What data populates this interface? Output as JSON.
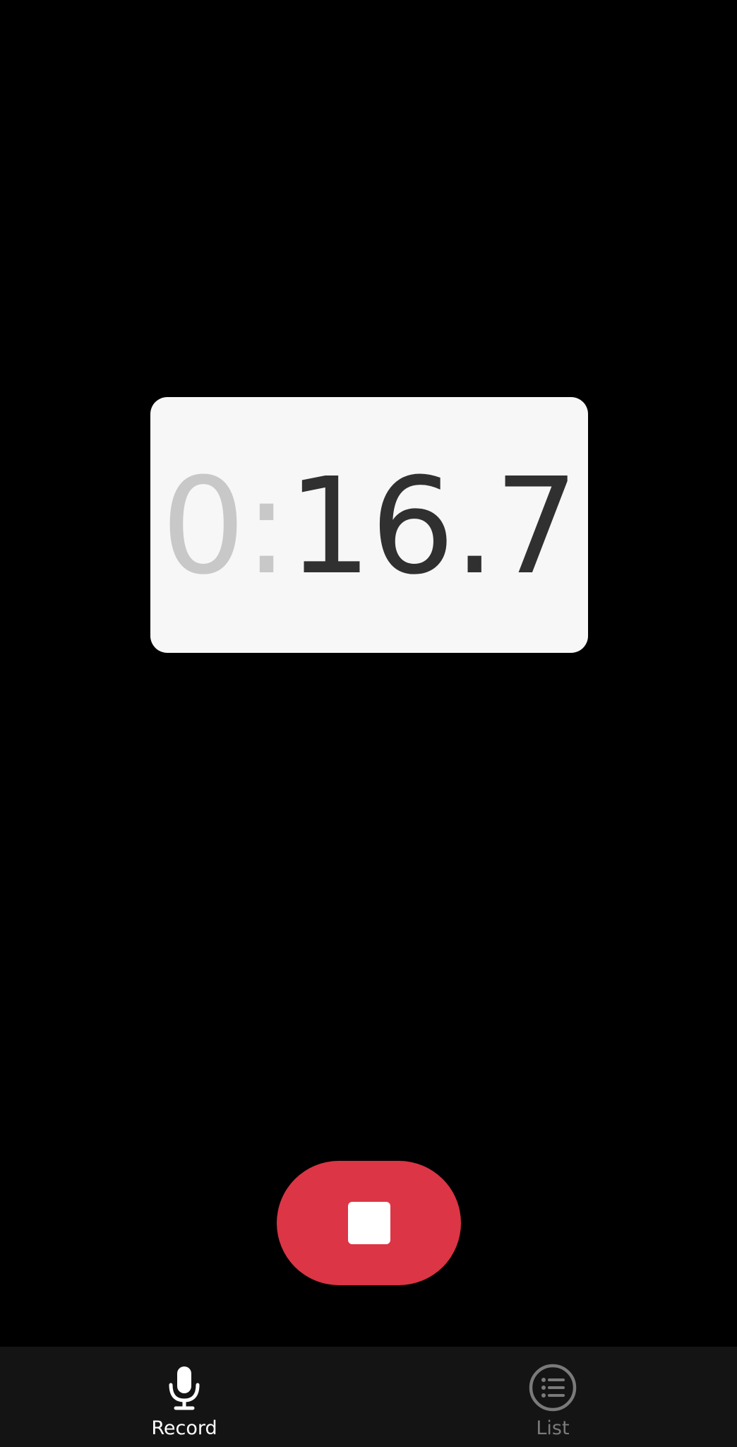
{
  "timer": {
    "prefix": "0:",
    "value": "16.7"
  },
  "controls": {
    "stop_icon": "stop-square-icon",
    "stop_color": "#dc3545"
  },
  "nav": {
    "items": [
      {
        "label": "Record",
        "icon": "microphone-icon",
        "active": true
      },
      {
        "label": "List",
        "icon": "list-icon",
        "active": false
      }
    ]
  },
  "colors": {
    "background": "#000000",
    "card": "#f7f7f7",
    "nav_background": "#141414",
    "accent": "#dc3545"
  }
}
